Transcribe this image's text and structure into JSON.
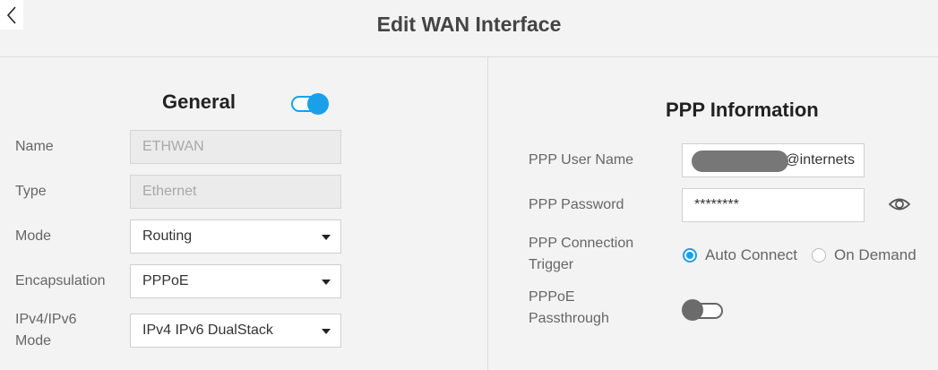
{
  "header": {
    "title": "Edit WAN Interface"
  },
  "general": {
    "title": "General",
    "enabled": true,
    "fields": {
      "name": {
        "label": "Name",
        "value": "ETHWAN"
      },
      "type": {
        "label": "Type",
        "value": "Ethernet"
      },
      "mode": {
        "label": "Mode",
        "value": "Routing"
      },
      "encapsulation": {
        "label": "Encapsulation",
        "value": "PPPoE"
      },
      "ip_mode": {
        "label_line1": "IPv4/IPv6",
        "label_line2": "Mode",
        "value": "IPv4 IPv6 DualStack"
      }
    }
  },
  "ppp": {
    "title": "PPP Information",
    "username": {
      "label": "PPP User Name",
      "value_suffix": "@internets"
    },
    "password": {
      "label": "PPP Password",
      "value": "********"
    },
    "trigger": {
      "label_line1": "PPP Connection",
      "label_line2": "Trigger",
      "options": [
        "Auto Connect",
        "On Demand"
      ],
      "selected": "Auto Connect"
    },
    "passthrough": {
      "label_line1": "PPPoE",
      "label_line2": "Passthrough",
      "enabled": false
    }
  },
  "colors": {
    "accent": "#1aa0e8",
    "background": "#f3f3f3"
  },
  "icons": {
    "back": "chevron-left-icon",
    "eye": "eye-icon",
    "caret": "caret-down-icon"
  }
}
